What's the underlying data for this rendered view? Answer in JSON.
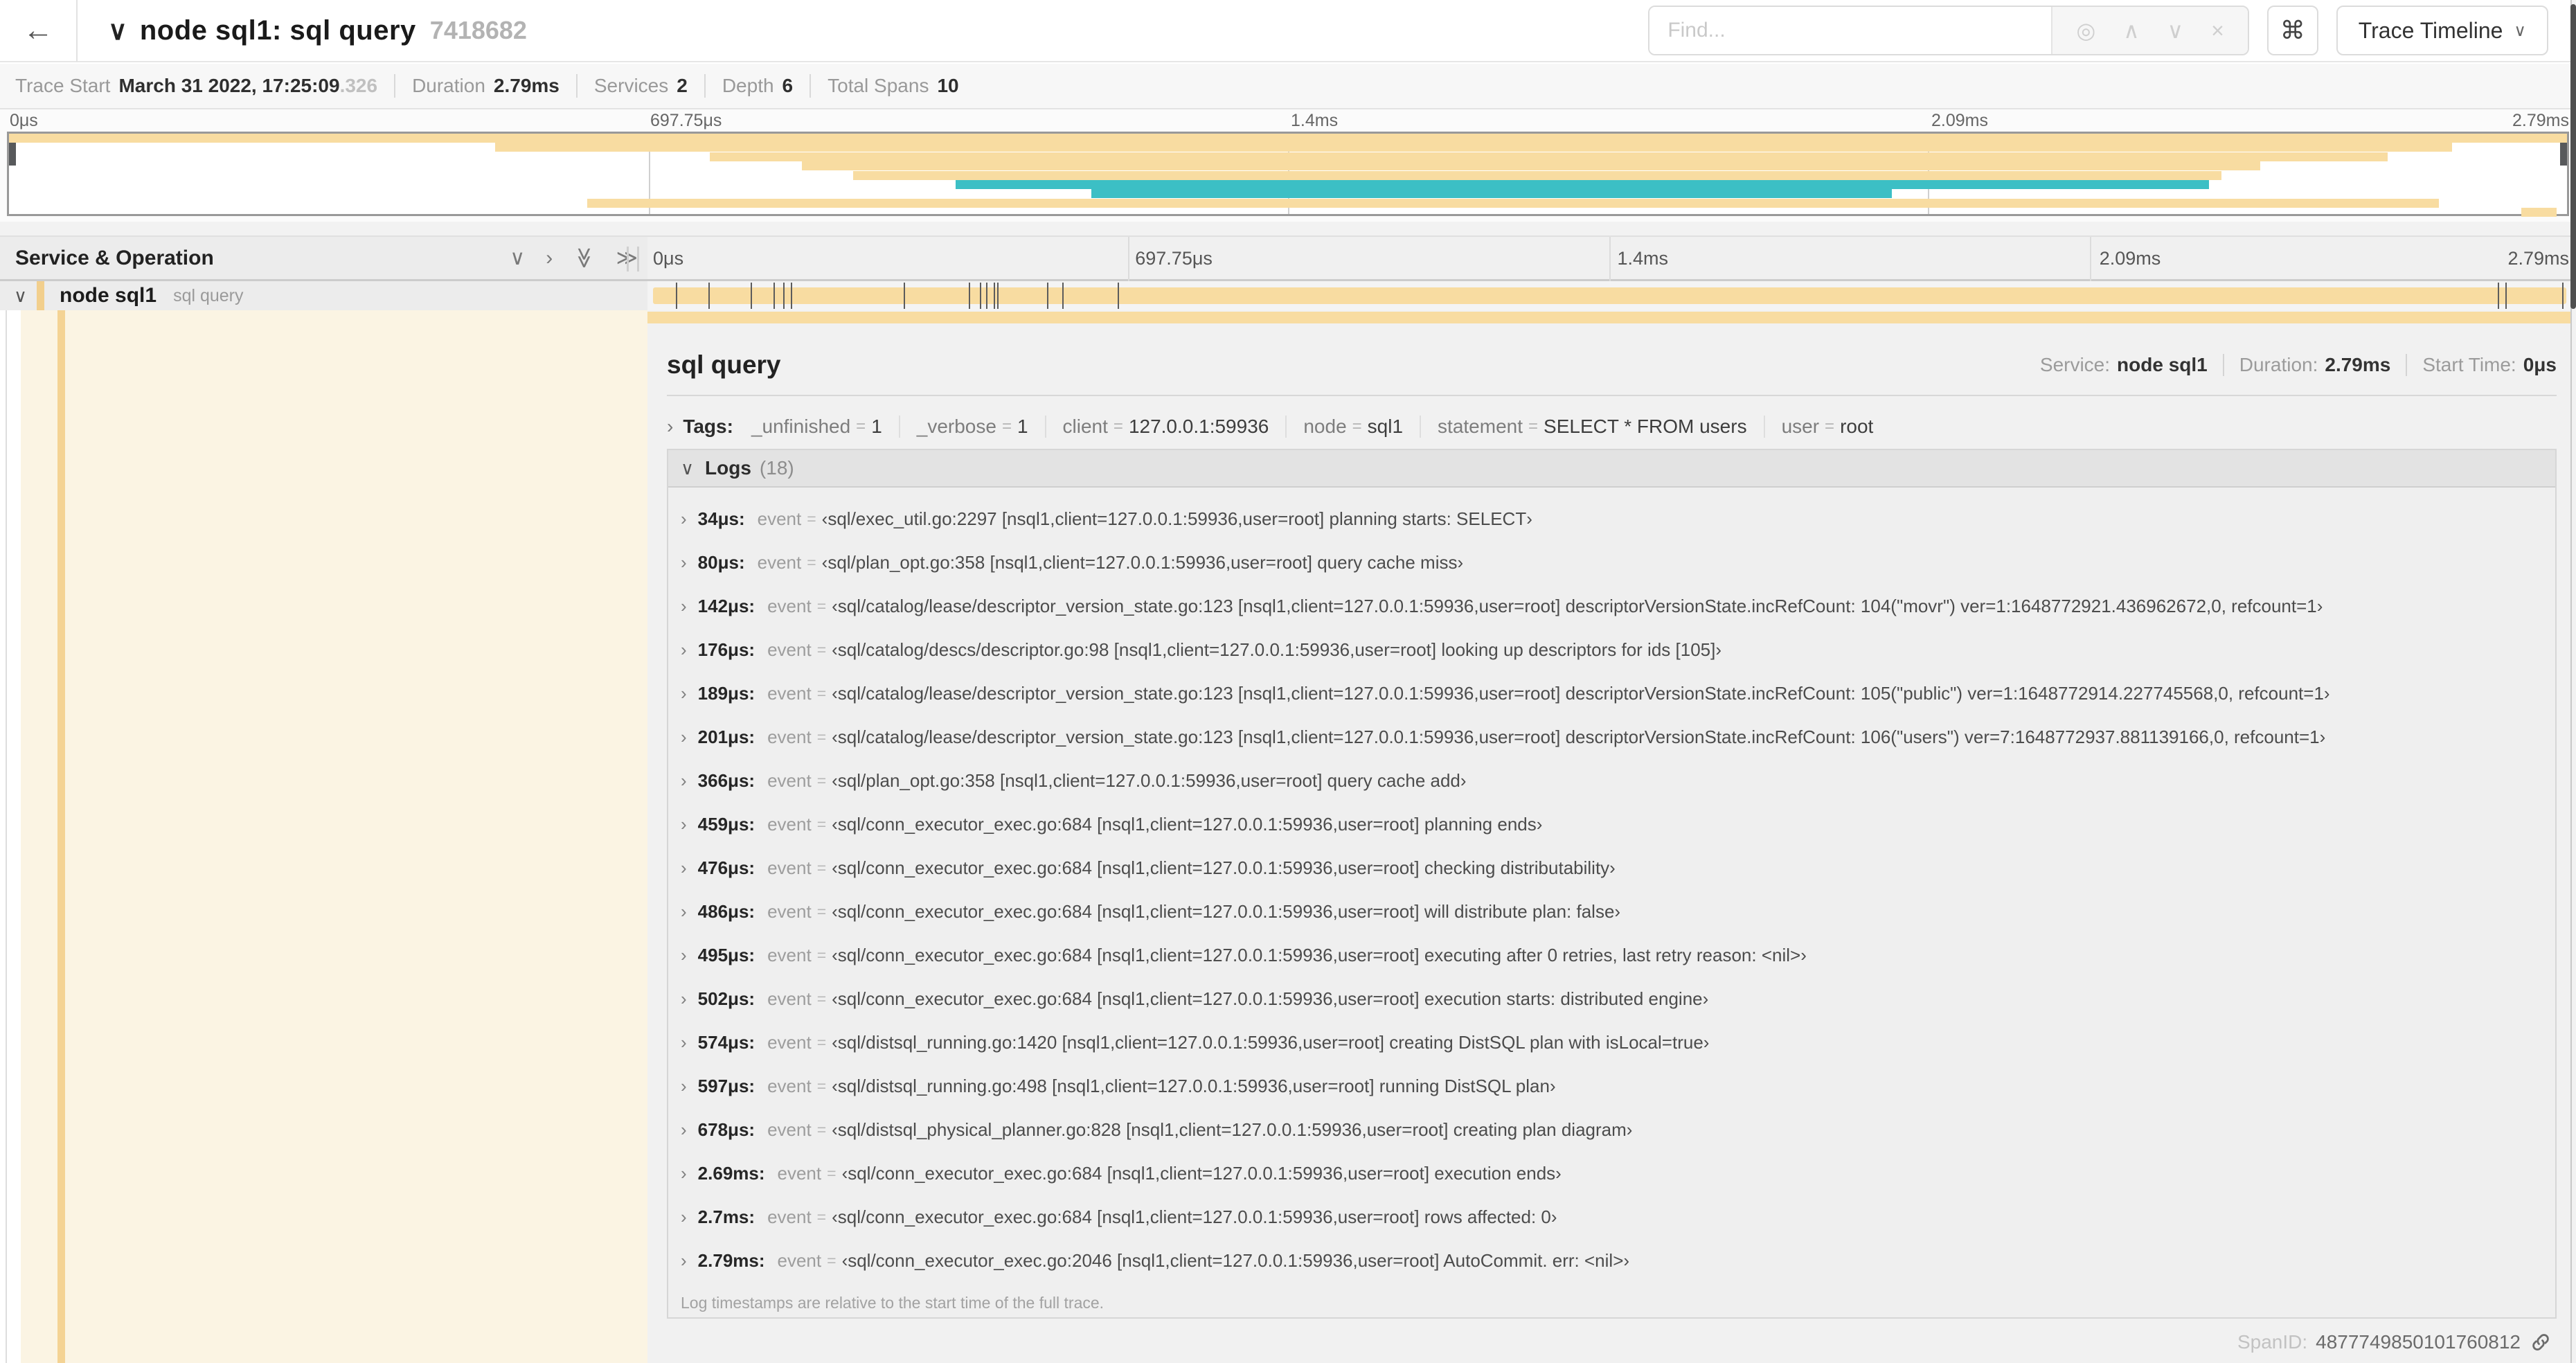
{
  "colors": {
    "tan": "#f8dca1",
    "teal": "#3cbfc5"
  },
  "header": {
    "back_icon": "←",
    "collapse_chevron": "∨",
    "title": "node sql1: sql query",
    "trace_id": "7418682",
    "find_placeholder": "Find...",
    "locate_icon": "◎",
    "prev_icon": "∧",
    "next_icon": "∨",
    "clear_icon": "×",
    "shortcut_button": "⌘",
    "view_selector_label": "Trace Timeline",
    "view_selector_chevron": "∨"
  },
  "trace_meta": {
    "trace_start_label": "Trace Start",
    "trace_start_value": "March 31 2022, 17:25:09",
    "trace_start_fraction": ".326",
    "duration_label": "Duration",
    "duration_value": "2.79ms",
    "services_label": "Services",
    "services_value": "2",
    "depth_label": "Depth",
    "depth_value": "6",
    "total_spans_label": "Total Spans",
    "total_spans_value": "10"
  },
  "minimap": {
    "ticks": [
      {
        "label": "0μs",
        "pos": 0
      },
      {
        "label": "697.75μs",
        "pos": 25
      },
      {
        "label": "1.4ms",
        "pos": 50
      },
      {
        "label": "2.09ms",
        "pos": 75
      },
      {
        "label": "2.79ms",
        "pos": 100
      }
    ],
    "spans": [
      {
        "color": "tan",
        "start": 0,
        "end": 100
      },
      {
        "color": "tan",
        "start": 19,
        "end": 95.5
      },
      {
        "color": "tan",
        "start": 27.4,
        "end": 93
      },
      {
        "color": "tan",
        "start": 31,
        "end": 88
      },
      {
        "color": "tan",
        "start": 33,
        "end": 86.5
      },
      {
        "color": "teal",
        "start": 37,
        "end": 86
      },
      {
        "color": "teal",
        "start": 42.3,
        "end": 73.6
      },
      {
        "color": "tan",
        "start": 22.6,
        "end": 95
      },
      {
        "color": "tan",
        "start": 98.2,
        "end": 99.6
      }
    ]
  },
  "timeline": {
    "left_header": "Service & Operation",
    "collapse_icons": {
      "collapse_one": "∨",
      "expand_one": "›",
      "collapse_all": "≫",
      "expand_all": "≫"
    },
    "ticks": [
      {
        "label": "0μs",
        "pos": 0
      },
      {
        "label": "697.75μs",
        "pos": 25
      },
      {
        "label": "1.4ms",
        "pos": 50
      },
      {
        "label": "2.09ms",
        "pos": 75
      },
      {
        "label": "2.79ms",
        "pos": 100
      }
    ],
    "row": {
      "chevron": "∨",
      "service": "node sql1",
      "operation": "sql query"
    },
    "log_markers": [
      1.2,
      2.9,
      5.1,
      6.3,
      6.8,
      7.2,
      13.1,
      16.5,
      17.1,
      17.4,
      17.8,
      18.0,
      20.6,
      21.4,
      24.3,
      96.4,
      96.8,
      99.8
    ]
  },
  "detail": {
    "title": "sql query",
    "overview": {
      "service_label": "Service:",
      "service_value": "node sql1",
      "duration_label": "Duration:",
      "duration_value": "2.79ms",
      "start_label": "Start Time:",
      "start_value": "0μs"
    },
    "tags_chevron": "›",
    "tags_label": "Tags:",
    "tags": [
      {
        "key": "_unfinished",
        "value": "1"
      },
      {
        "key": "_verbose",
        "value": "1"
      },
      {
        "key": "client",
        "value": "127.0.0.1:59936"
      },
      {
        "key": "node",
        "value": "sql1"
      },
      {
        "key": "statement",
        "value": "SELECT * FROM users"
      },
      {
        "key": "user",
        "value": "root"
      }
    ],
    "logs_chevron": "∨",
    "logs_label": "Logs",
    "logs_count": "(18)",
    "logs": [
      {
        "time": "34μs:",
        "key": "event",
        "value": "‹sql/exec_util.go:2297 [nsql1,client=127.0.0.1:59936,user=root] planning starts: SELECT›"
      },
      {
        "time": "80μs:",
        "key": "event",
        "value": "‹sql/plan_opt.go:358 [nsql1,client=127.0.0.1:59936,user=root] query cache miss›"
      },
      {
        "time": "142μs:",
        "key": "event",
        "value": "‹sql/catalog/lease/descriptor_version_state.go:123 [nsql1,client=127.0.0.1:59936,user=root] descriptorVersionState.incRefCount: 104(\"movr\") ver=1:1648772921.436962672,0, refcount=1›"
      },
      {
        "time": "176μs:",
        "key": "event",
        "value": "‹sql/catalog/descs/descriptor.go:98 [nsql1,client=127.0.0.1:59936,user=root] looking up descriptors for ids [105]›"
      },
      {
        "time": "189μs:",
        "key": "event",
        "value": "‹sql/catalog/lease/descriptor_version_state.go:123 [nsql1,client=127.0.0.1:59936,user=root] descriptorVersionState.incRefCount: 105(\"public\") ver=1:1648772914.227745568,0, refcount=1›"
      },
      {
        "time": "201μs:",
        "key": "event",
        "value": "‹sql/catalog/lease/descriptor_version_state.go:123 [nsql1,client=127.0.0.1:59936,user=root] descriptorVersionState.incRefCount: 106(\"users\") ver=7:1648772937.881139166,0, refcount=1›"
      },
      {
        "time": "366μs:",
        "key": "event",
        "value": "‹sql/plan_opt.go:358 [nsql1,client=127.0.0.1:59936,user=root] query cache add›"
      },
      {
        "time": "459μs:",
        "key": "event",
        "value": "‹sql/conn_executor_exec.go:684 [nsql1,client=127.0.0.1:59936,user=root] planning ends›"
      },
      {
        "time": "476μs:",
        "key": "event",
        "value": "‹sql/conn_executor_exec.go:684 [nsql1,client=127.0.0.1:59936,user=root] checking distributability›"
      },
      {
        "time": "486μs:",
        "key": "event",
        "value": "‹sql/conn_executor_exec.go:684 [nsql1,client=127.0.0.1:59936,user=root] will distribute plan: false›"
      },
      {
        "time": "495μs:",
        "key": "event",
        "value": "‹sql/conn_executor_exec.go:684 [nsql1,client=127.0.0.1:59936,user=root] executing after 0 retries, last retry reason: <nil>›"
      },
      {
        "time": "502μs:",
        "key": "event",
        "value": "‹sql/conn_executor_exec.go:684 [nsql1,client=127.0.0.1:59936,user=root] execution starts: distributed engine›"
      },
      {
        "time": "574μs:",
        "key": "event",
        "value": "‹sql/distsql_running.go:1420 [nsql1,client=127.0.0.1:59936,user=root] creating DistSQL plan with isLocal=true›"
      },
      {
        "time": "597μs:",
        "key": "event",
        "value": "‹sql/distsql_running.go:498 [nsql1,client=127.0.0.1:59936,user=root] running DistSQL plan›"
      },
      {
        "time": "678μs:",
        "key": "event",
        "value": "‹sql/distsql_physical_planner.go:828 [nsql1,client=127.0.0.1:59936,user=root] creating plan diagram›"
      },
      {
        "time": "2.69ms:",
        "key": "event",
        "value": "‹sql/conn_executor_exec.go:684 [nsql1,client=127.0.0.1:59936,user=root] execution ends›"
      },
      {
        "time": "2.7ms:",
        "key": "event",
        "value": "‹sql/conn_executor_exec.go:684 [nsql1,client=127.0.0.1:59936,user=root] rows affected: 0›"
      },
      {
        "time": "2.79ms:",
        "key": "event",
        "value": "‹sql/conn_executor_exec.go:2046 [nsql1,client=127.0.0.1:59936,user=root] AutoCommit. err: <nil>›"
      }
    ],
    "logs_note": "Log timestamps are relative to the start time of the full trace.",
    "spanid_label": "SpanID:",
    "spanid_value": "4877749850101760812"
  }
}
